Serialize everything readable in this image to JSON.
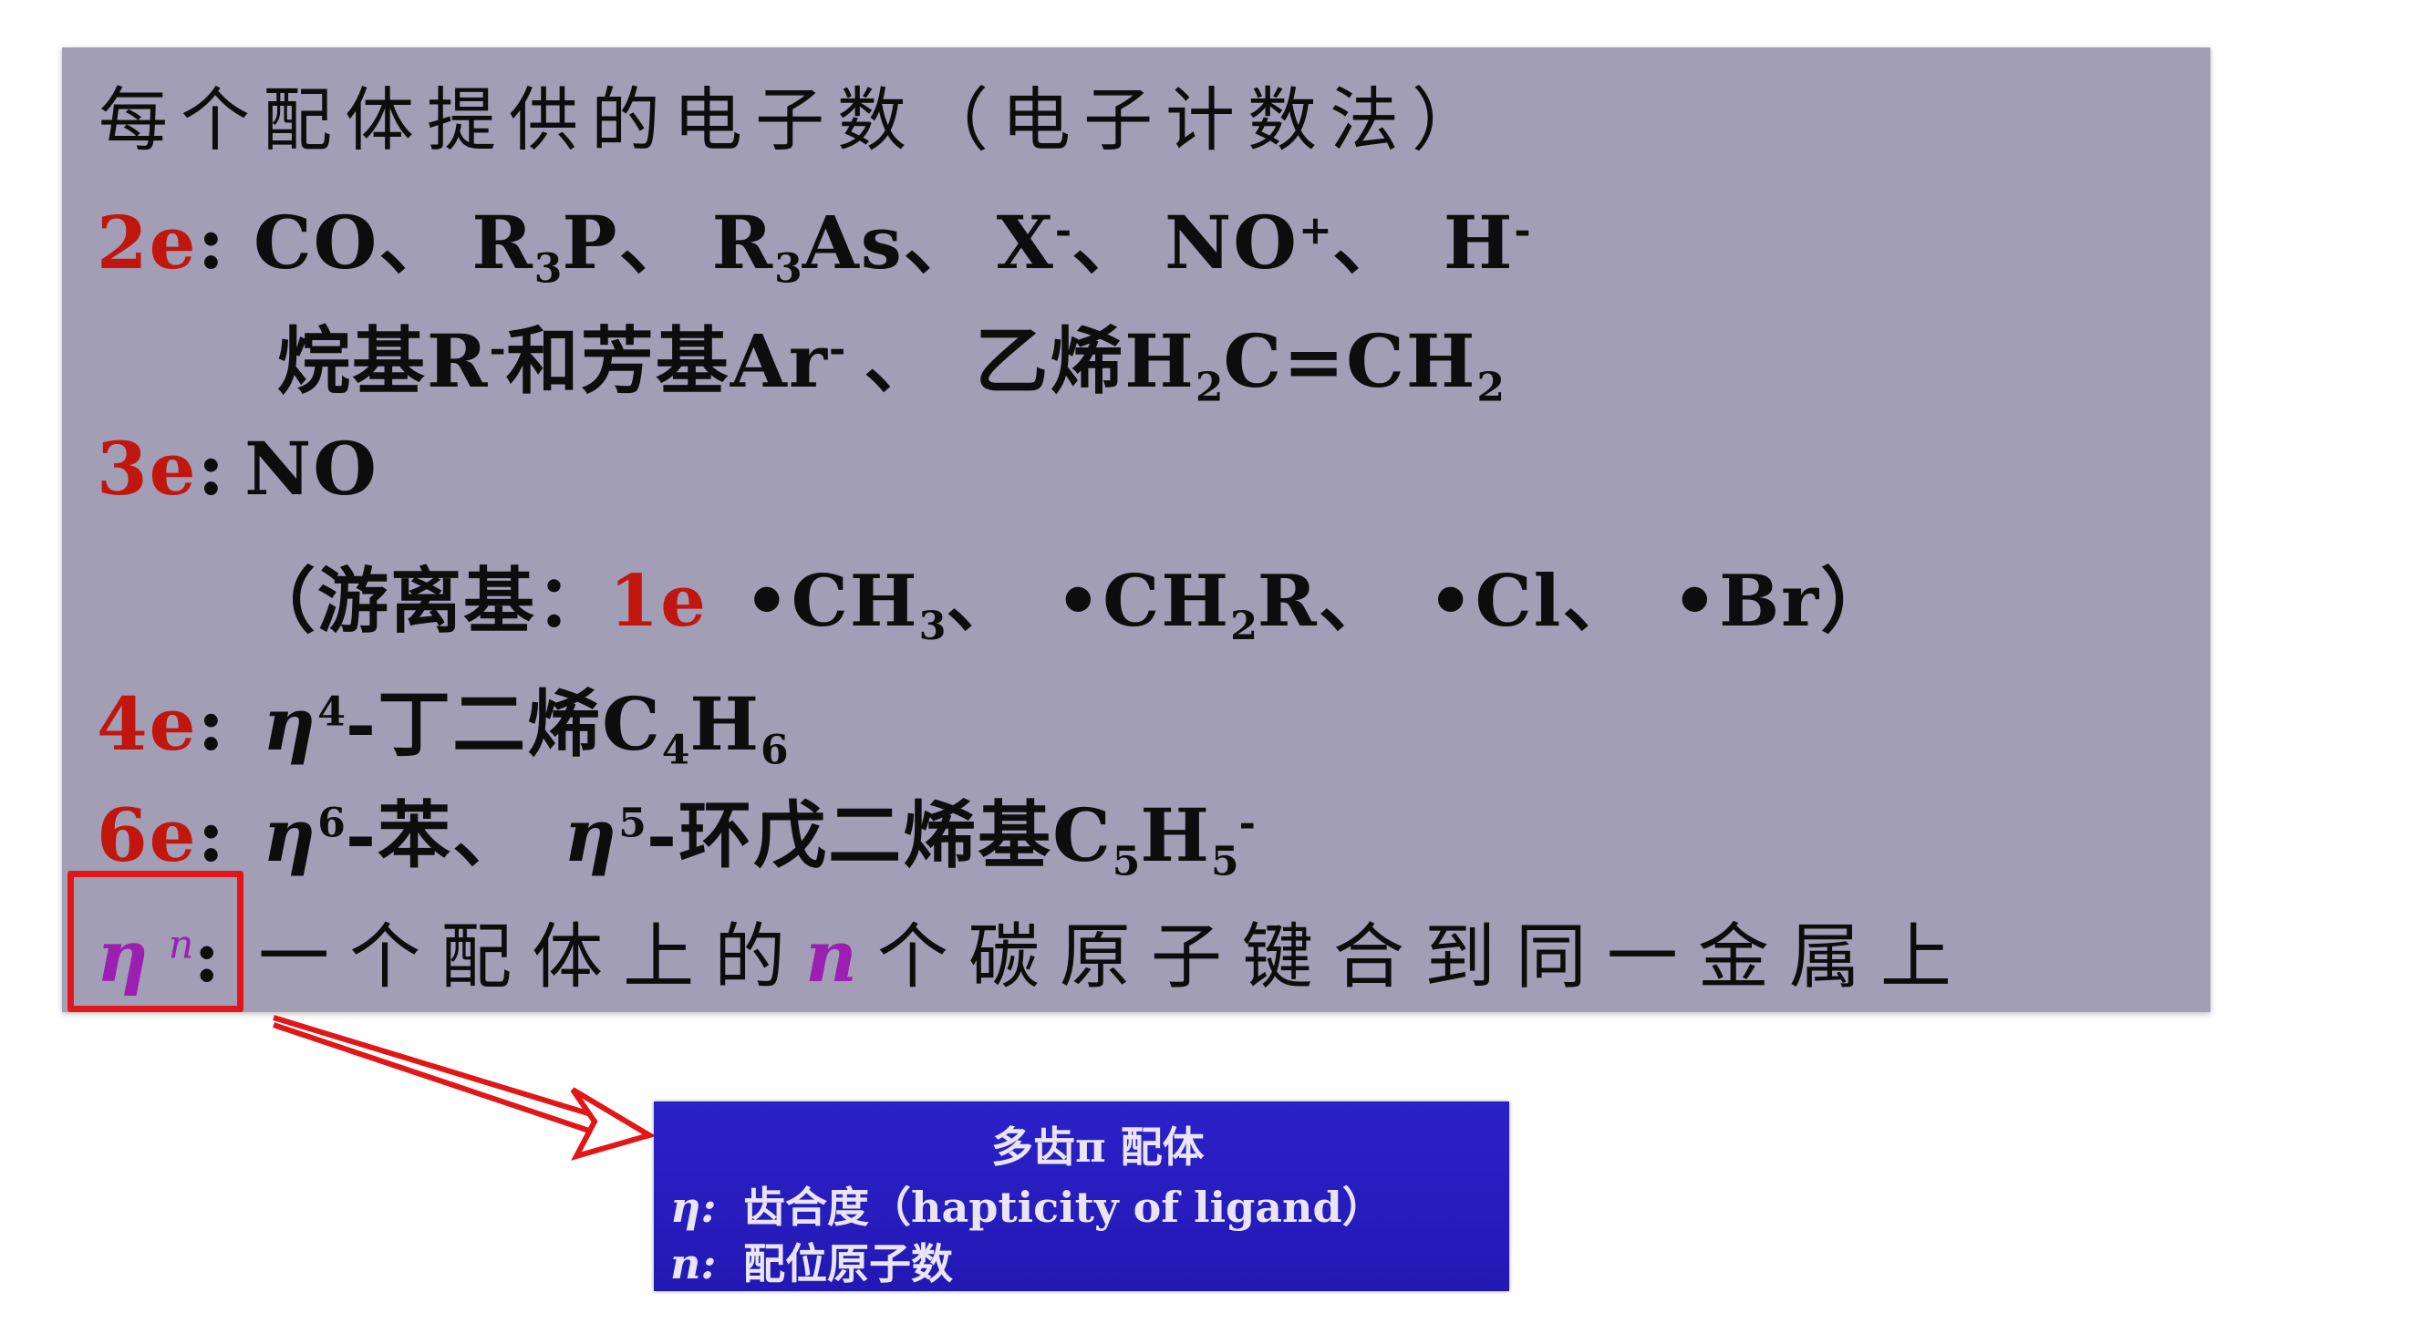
{
  "slide": {
    "title": "每个配体提供的电子数（电子计数法）",
    "row_2e": {
      "label": "2e",
      "colon": ":",
      "items": [
        "CO",
        "R",
        "3",
        "P",
        "R",
        "3",
        "As",
        "X",
        "-",
        "NO",
        "+",
        "H",
        "-"
      ],
      "sep": "、"
    },
    "row_2e_cont": {
      "alkyl_text": "烷基R",
      "alkyl_sup": "-",
      "and_text": "和芳基Ar",
      "aryl_sup": "-",
      "sep": "、",
      "ethylene_text": "乙烯H",
      "ethylene_sub": "2",
      "ethylene_mid": "C=CH",
      "ethylene_sub2": "2"
    },
    "row_3e": {
      "label": "3e",
      "colon": ":",
      "value": "NO"
    },
    "row_radical": {
      "open": "（游离基：",
      "one_e": "1e",
      "ch3": "•CH",
      "ch3_sub": "3",
      "sep": "、",
      "ch2r": "•CH",
      "ch2r_sub": "2",
      "ch2r_tail": "R",
      "cl": "•Cl",
      "br": "•Br",
      "close": "）"
    },
    "row_4e": {
      "label": "4e",
      "colon": ":",
      "eta": "η",
      "eta_sup": "4",
      "text": "-丁二烯C",
      "sub1": "4",
      "mid": "H",
      "sub2": "6"
    },
    "row_6e": {
      "label": "6e",
      "colon": ":",
      "eta1": "η",
      "eta1_sup": "6",
      "benzene": "-苯",
      "sep": "、",
      "eta2": "η",
      "eta2_sup": "5",
      "cp_text": "-环戊二烯基C",
      "cp_sub1": "5",
      "cp_mid": "H",
      "cp_sub2": "5",
      "cp_sup": "-"
    },
    "row_etan": {
      "eta": "η",
      "eta_sup": "n",
      "colon": ":",
      "text1": "一个配体上的",
      "n": "n",
      "text2": "个碳原子键合到同一金属上"
    }
  },
  "info_box": {
    "title": "多齿π 配体",
    "row1_key": "η:",
    "row1_value": "齿合度（hapticity of ligand）",
    "row2_key": "n:",
    "row2_value": "配位原子数"
  },
  "colors": {
    "slide_bg": "#a29eb6",
    "accent_red": "#c0160e",
    "accent_magenta": "#9b1fb0",
    "highlight": "#e21616",
    "info_bg": "#2a20c4"
  }
}
